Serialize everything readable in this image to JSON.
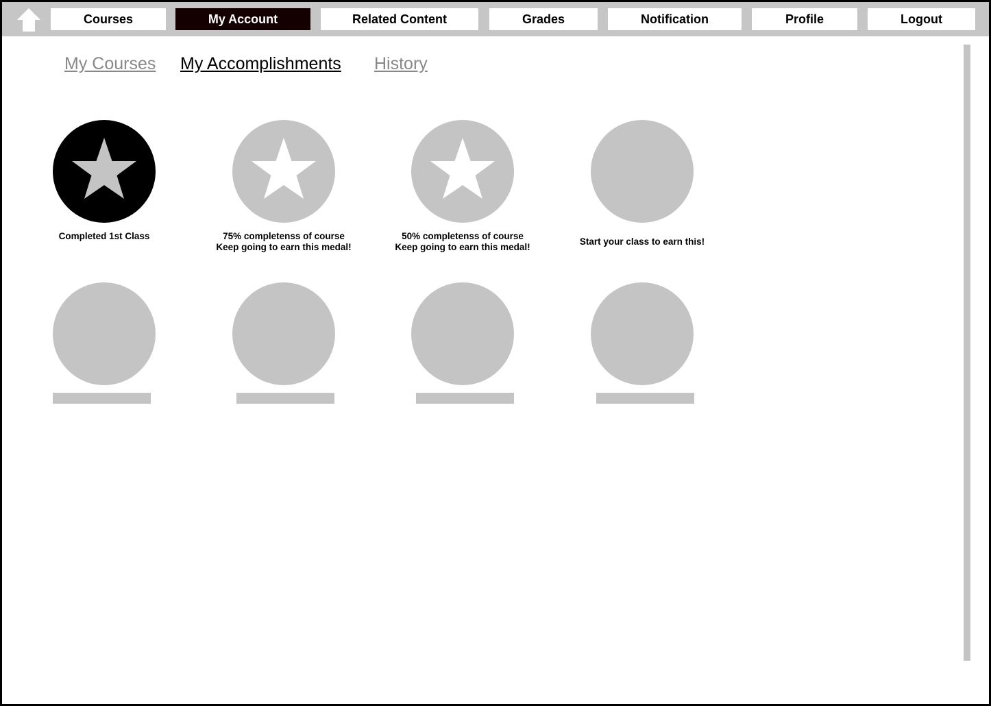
{
  "nav": {
    "home_icon": "home-icon",
    "items": [
      {
        "label": "Courses",
        "active": false
      },
      {
        "label": "My Account",
        "active": true
      },
      {
        "label": "Related Content",
        "active": false
      },
      {
        "label": "Grades",
        "active": false
      },
      {
        "label": "Notification",
        "active": false
      },
      {
        "label": "Profile",
        "active": false
      },
      {
        "label": "Logout",
        "active": false
      }
    ]
  },
  "tabs": [
    {
      "label": "My Courses",
      "active": false
    },
    {
      "label": "My Accomplishments",
      "active": true
    },
    {
      "label": "History",
      "active": false
    }
  ],
  "medals": [
    {
      "icon": "star-icon",
      "state": "earned",
      "caption_line1": "Completed 1st Class",
      "caption_line2": ""
    },
    {
      "icon": "star-icon",
      "state": "in-progress",
      "progress_percent": 75,
      "caption_line1": "75% completenss of course",
      "caption_line2": "Keep going to earn this medal!"
    },
    {
      "icon": "star-icon",
      "state": "in-progress",
      "progress_percent": 50,
      "caption_line1": "50% completenss of course",
      "caption_line2": "Keep going to earn this medal!"
    },
    {
      "icon": "",
      "state": "locked",
      "caption_line1": "Start your class to earn this!",
      "caption_line2": ""
    },
    {
      "icon": "",
      "state": "placeholder"
    },
    {
      "icon": "",
      "state": "placeholder"
    },
    {
      "icon": "",
      "state": "placeholder"
    },
    {
      "icon": "",
      "state": "placeholder"
    }
  ],
  "colors": {
    "earned": "#000000",
    "inactive": "#c4c4c4",
    "star_on_earned": "#c4c4c4",
    "star_on_inactive": "#ffffff",
    "active_nav_bg": "#140000",
    "topbar": "#c6c6c6"
  }
}
